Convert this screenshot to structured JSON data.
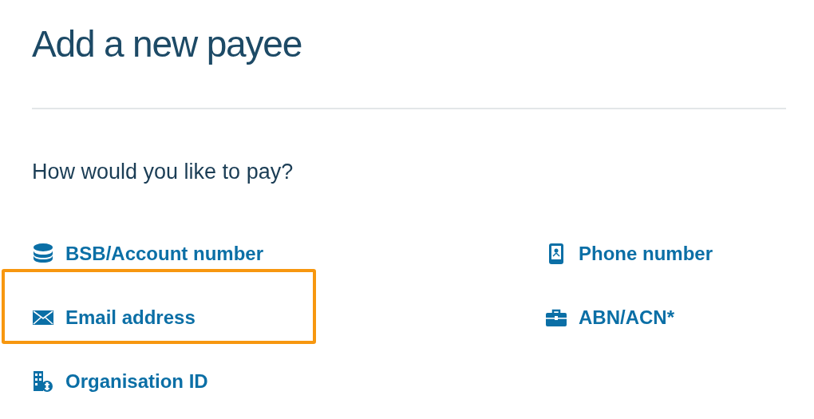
{
  "title": "Add a new payee",
  "question": "How would you like to pay?",
  "options": [
    {
      "kind": "bsb",
      "label": "BSB/Account number",
      "highlighted": false
    },
    {
      "kind": "phone",
      "label": "Phone number",
      "highlighted": false
    },
    {
      "kind": "email",
      "label": "Email address",
      "highlighted": true
    },
    {
      "kind": "abn",
      "label": "ABN/ACN*",
      "highlighted": false
    },
    {
      "kind": "organisation",
      "label": "Organisation ID",
      "highlighted": false
    }
  ]
}
